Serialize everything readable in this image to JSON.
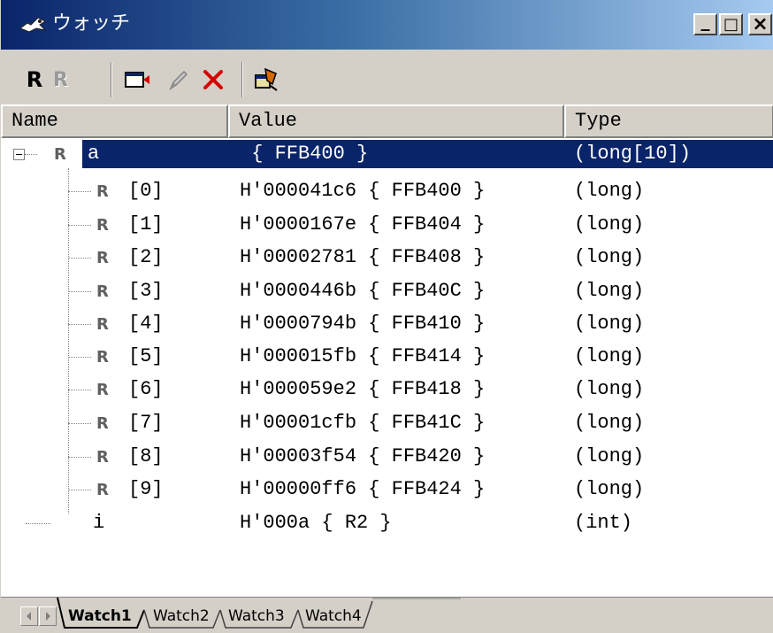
{
  "window": {
    "title": "ウォッチ",
    "controls": {
      "minimize": "_",
      "maximize": "□",
      "close": "×"
    }
  },
  "toolbar": {
    "buttons": [
      {
        "name": "refresh",
        "label": "R",
        "enabled": true
      },
      {
        "name": "refresh-disabled",
        "label": "R",
        "enabled": false
      },
      {
        "name": "add-watch",
        "icon": "add-watch-icon"
      },
      {
        "name": "edit-value",
        "icon": "pencil-icon"
      },
      {
        "name": "delete",
        "icon": "delete-x-icon"
      },
      {
        "name": "properties",
        "icon": "properties-icon"
      }
    ]
  },
  "columns": {
    "name": "Name",
    "value": "Value",
    "type": "Type"
  },
  "rows": [
    {
      "name": "a",
      "value": " { FFB400 }",
      "type": "(long[10])",
      "selected": true,
      "level": 0,
      "expandable": true
    },
    {
      "name": "[0]",
      "value": "H'000041c6 { FFB400 }",
      "type": "(long)",
      "level": 1
    },
    {
      "name": "[1]",
      "value": "H'0000167e { FFB404 }",
      "type": "(long)",
      "level": 1
    },
    {
      "name": "[2]",
      "value": "H'00002781 { FFB408 }",
      "type": "(long)",
      "level": 1
    },
    {
      "name": "[3]",
      "value": "H'0000446b { FFB40C }",
      "type": "(long)",
      "level": 1
    },
    {
      "name": "[4]",
      "value": "H'0000794b { FFB410 }",
      "type": "(long)",
      "level": 1
    },
    {
      "name": "[5]",
      "value": "H'000015fb { FFB414 }",
      "type": "(long)",
      "level": 1
    },
    {
      "name": "[6]",
      "value": "H'000059e2 { FFB418 }",
      "type": "(long)",
      "level": 1
    },
    {
      "name": "[7]",
      "value": "H'00001cfb { FFB41C }",
      "type": "(long)",
      "level": 1
    },
    {
      "name": "[8]",
      "value": "H'00003f54 { FFB420 }",
      "type": "(long)",
      "level": 1
    },
    {
      "name": "[9]",
      "value": "H'00000ff6 { FFB424 }",
      "type": "(long)",
      "level": 1
    },
    {
      "name": "i",
      "value": "H'000a { R2 }",
      "type": "(int)",
      "level": 0,
      "expandable": false
    }
  ],
  "tabs": [
    {
      "label": "Watch1",
      "active": true
    },
    {
      "label": "Watch2",
      "active": false
    },
    {
      "label": "Watch3",
      "active": false
    },
    {
      "label": "Watch4",
      "active": false
    }
  ],
  "colors": {
    "titlebar_start": "#0a246a",
    "titlebar_end": "#a6caf0",
    "selection": "#0a246a",
    "face": "#d4d0c8",
    "delete_red": "#d40000"
  }
}
